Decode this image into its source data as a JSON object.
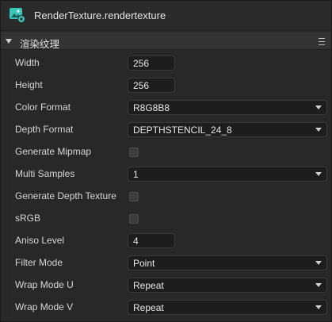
{
  "window": {
    "title": "RenderTexture.rendertexture"
  },
  "section": {
    "title": "渲染纹理"
  },
  "fields": {
    "width": {
      "label": "Width",
      "value": "256"
    },
    "height": {
      "label": "Height",
      "value": "256"
    },
    "color_format": {
      "label": "Color Format",
      "value": "R8G8B8"
    },
    "depth_format": {
      "label": "Depth Format",
      "value": "DEPTHSTENCIL_24_8"
    },
    "generate_mipmap": {
      "label": "Generate Mipmap",
      "checked": false
    },
    "multi_samples": {
      "label": "Multi Samples",
      "value": "1"
    },
    "generate_depth_texture": {
      "label": "Generate Depth Texture",
      "checked": false
    },
    "srgb": {
      "label": "sRGB",
      "checked": false
    },
    "aniso_level": {
      "label": "Aniso Level",
      "value": "4"
    },
    "filter_mode": {
      "label": "Filter Mode",
      "value": "Point"
    },
    "wrap_mode_u": {
      "label": "Wrap Mode U",
      "value": "Repeat"
    },
    "wrap_mode_v": {
      "label": "Wrap Mode V",
      "value": "Repeat"
    }
  },
  "icons": {
    "file": "render-texture-icon",
    "collapse": "triangle-down-icon",
    "menu": "hamburger-menu-icon",
    "dropdown": "chevron-down-icon"
  },
  "colors": {
    "panel_bg": "#2a2a2a",
    "input_bg": "#1d1d1d",
    "icon_teal": "#39c6b9"
  }
}
